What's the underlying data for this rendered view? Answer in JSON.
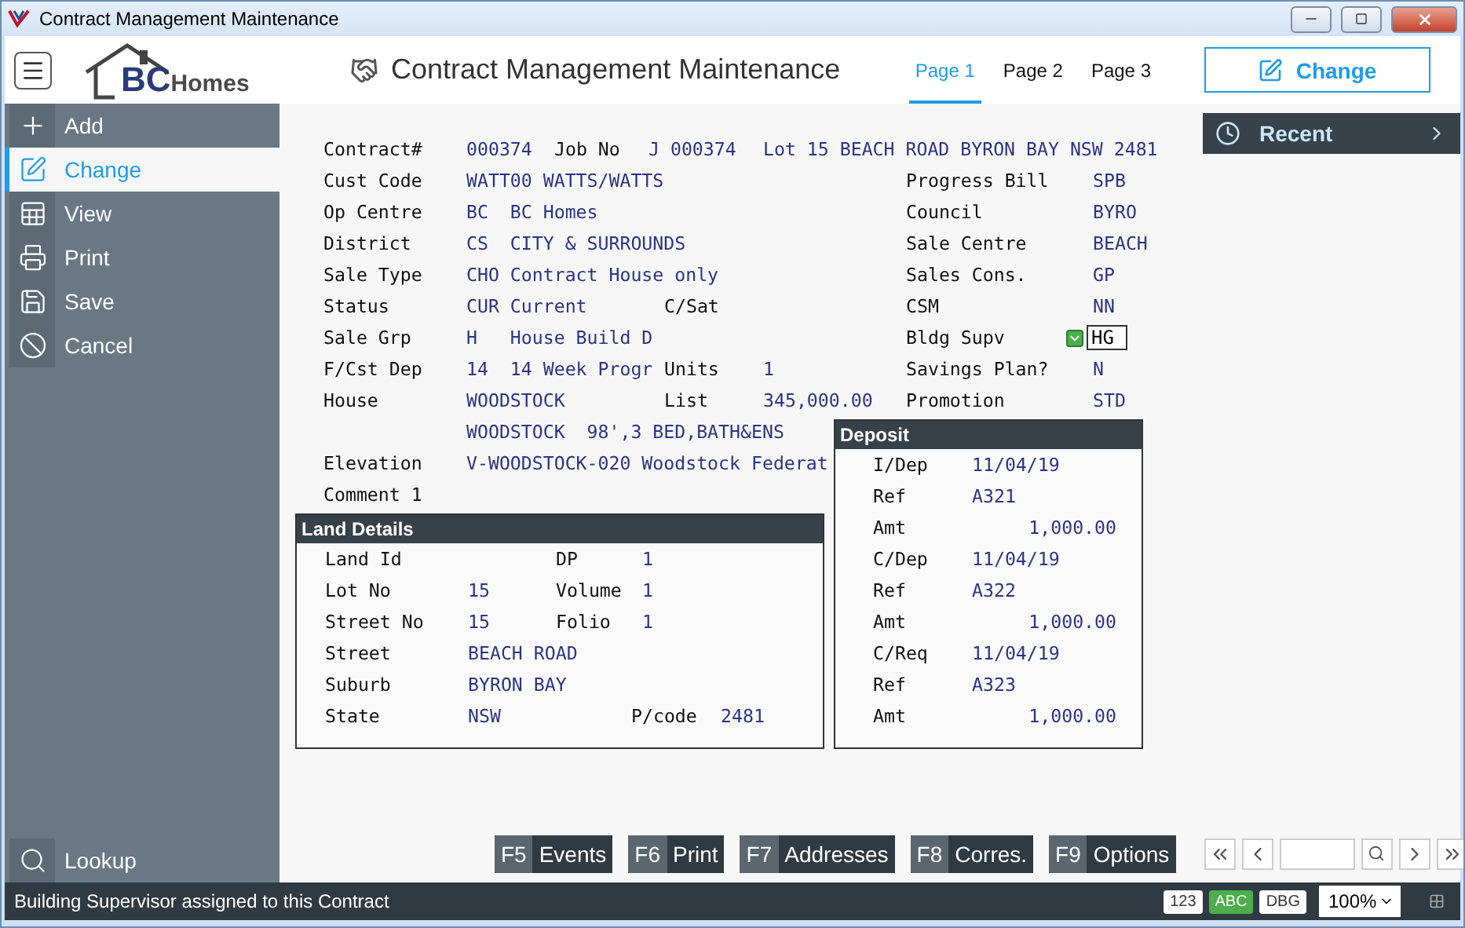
{
  "window": {
    "title": "Contract Management Maintenance"
  },
  "header": {
    "logo": {
      "initials": "BC",
      "name": "Homes"
    },
    "title": "Contract Management Maintenance",
    "tabs": [
      {
        "label": "Page 1",
        "selected": true
      },
      {
        "label": "Page 2",
        "selected": false
      },
      {
        "label": "Page 3",
        "selected": false
      }
    ],
    "action_button": "Change"
  },
  "sidebar": {
    "items": [
      {
        "label": "Add",
        "selected": false
      },
      {
        "label": "Change",
        "selected": true
      },
      {
        "label": "View",
        "selected": false
      },
      {
        "label": "Print",
        "selected": false
      },
      {
        "label": "Save",
        "selected": false
      },
      {
        "label": "Cancel",
        "selected": false
      }
    ],
    "lookup": "Lookup"
  },
  "form": {
    "header_row": {
      "label": "Contract#",
      "value": "000374",
      "job_label": "Job No",
      "job_value": "J 000374",
      "address": "Lot 15 BEACH ROAD BYRON BAY NSW 2481"
    },
    "rows": [
      {
        "kind": "plain",
        "label": "Cust Code",
        "value": "WATT00 WATTS/WATTS",
        "right_label": "Progress Bill",
        "right_value": "SPB"
      },
      {
        "kind": "plain",
        "label": "Op Centre",
        "value": "BC  BC Homes",
        "right_label": "Council",
        "right_value": "BYRO"
      },
      {
        "kind": "plain",
        "label": "District",
        "value": "CS  CITY & SURROUNDS",
        "right_label": "Sale Centre",
        "right_value": "BEACH"
      },
      {
        "kind": "plain",
        "label": "Sale Type",
        "value": "CHO Contract House only",
        "right_label": "Sales Cons.",
        "right_value": "GP"
      },
      {
        "kind": "plain",
        "label": "Status",
        "value": "CUR Current",
        "mid_label": "C/Sat",
        "right_label": "CSM",
        "right_value": "NN"
      },
      {
        "kind": "field",
        "label": "Sale Grp",
        "value": "H   House Build D",
        "right_label": "Bldg Supv",
        "right_value": "HG"
      },
      {
        "kind": "plain",
        "label": "F/Cst Dep",
        "value": "14  14 Week Progr",
        "mid_label": "Units",
        "mid_value": "1",
        "right_label": "Savings Plan?",
        "right_value": "N"
      },
      {
        "kind": "plain",
        "label": "House",
        "value": "WOODSTOCK",
        "mid_label": "List",
        "mid_value": "345,000.00",
        "right_label": "Promotion",
        "right_value": "STD"
      }
    ],
    "lower_rows": [
      {
        "label": "",
        "value": "WOODSTOCK  98',3 BED,BATH&ENS"
      },
      {
        "label": "Elevation",
        "value": "V-WOODSTOCK-020 Woodstock Federat"
      },
      {
        "label": "Comment 1",
        "value": ""
      }
    ],
    "land_details": {
      "title": "Land Details",
      "rows": [
        {
          "label": "Land Id",
          "mid_label": "DP",
          "mid_value": "1"
        },
        {
          "label": "Lot No",
          "value": "15",
          "mid_label": "Volume",
          "mid_value": "1"
        },
        {
          "label": "Street No",
          "value": "15",
          "mid_label": "Folio",
          "mid_value": "1"
        },
        {
          "label": "Street",
          "value": "BEACH ROAD"
        },
        {
          "label": "Suburb",
          "value": "BYRON BAY"
        },
        {
          "label": "State",
          "value": "NSW",
          "far_label": "P/code",
          "far_value": "2481"
        }
      ]
    },
    "deposit": {
      "title": "Deposit",
      "rows": [
        {
          "kind": "date",
          "label": "I/Dep",
          "value": "11/04/19"
        },
        {
          "kind": "ref",
          "label": "Ref",
          "value": "A321"
        },
        {
          "kind": "amount",
          "label": "Amt",
          "value": "1,000.00"
        },
        {
          "kind": "date",
          "label": "C/Dep",
          "value": "11/04/19"
        },
        {
          "kind": "ref",
          "label": "Ref",
          "value": "A322"
        },
        {
          "kind": "amount",
          "label": "Amt",
          "value": "1,000.00"
        },
        {
          "kind": "date",
          "label": "C/Req",
          "value": "11/04/19"
        },
        {
          "kind": "ref",
          "label": "Ref",
          "value": "A323"
        },
        {
          "kind": "amount",
          "label": "Amt",
          "value": "1,000.00"
        }
      ]
    }
  },
  "recent": {
    "label": "Recent"
  },
  "function_keys": [
    {
      "key": "F5",
      "label": "Events"
    },
    {
      "key": "F6",
      "label": "Print"
    },
    {
      "key": "F7",
      "label": "Addresses"
    },
    {
      "key": "F8",
      "label": "Corres."
    },
    {
      "key": "F9",
      "label": "Options"
    }
  ],
  "status_bar": {
    "message": "Building Supervisor assigned to this Contract",
    "badges": [
      {
        "label": "123",
        "on": false
      },
      {
        "label": "ABC",
        "on": true
      },
      {
        "label": "DBG",
        "on": false
      }
    ],
    "zoom": "100%"
  }
}
